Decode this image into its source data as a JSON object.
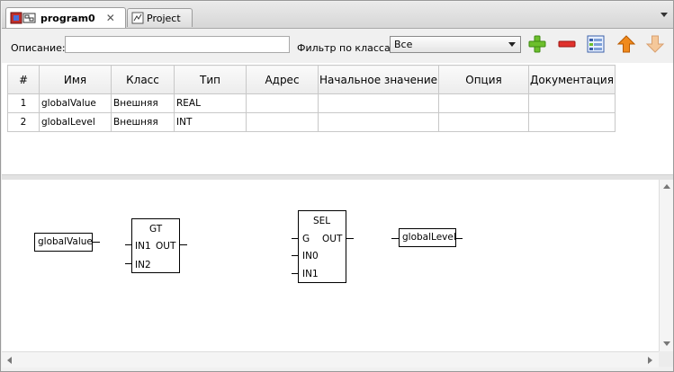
{
  "tabs": [
    {
      "label": "program0",
      "active": true
    },
    {
      "label": "Project",
      "active": false
    }
  ],
  "toolbar": {
    "description_label": "Описание:",
    "description_value": "",
    "filter_label": "Фильтр по классам:",
    "filter_value": "Все",
    "add_icon": "green-plus-icon",
    "remove_icon": "red-minus-icon",
    "edit_icon": "table-list-icon",
    "up_icon": "orange-up-arrow-icon",
    "down_icon": "orange-down-arrow-icon"
  },
  "table": {
    "columns": [
      "#",
      "Имя",
      "Класс",
      "Тип",
      "Адрес",
      "Начальное значение",
      "Опция",
      "Документация"
    ],
    "rows": [
      {
        "num": "1",
        "name": "globalValue",
        "class": "Внешняя",
        "type": "REAL",
        "address": "",
        "initial": "",
        "option": "",
        "doc": ""
      },
      {
        "num": "2",
        "name": "globalLevel",
        "class": "Внешняя",
        "type": "INT",
        "address": "",
        "initial": "",
        "option": "",
        "doc": ""
      }
    ]
  },
  "diagram": {
    "input_var": "globalValue",
    "output_var": "globalLevel",
    "gt_block": {
      "name": "GT",
      "in1": "IN1",
      "in2": "IN2",
      "out": "OUT"
    },
    "sel_block": {
      "name": "SEL",
      "g": "G",
      "in0": "IN0",
      "in1": "IN1",
      "out": "OUT"
    }
  }
}
